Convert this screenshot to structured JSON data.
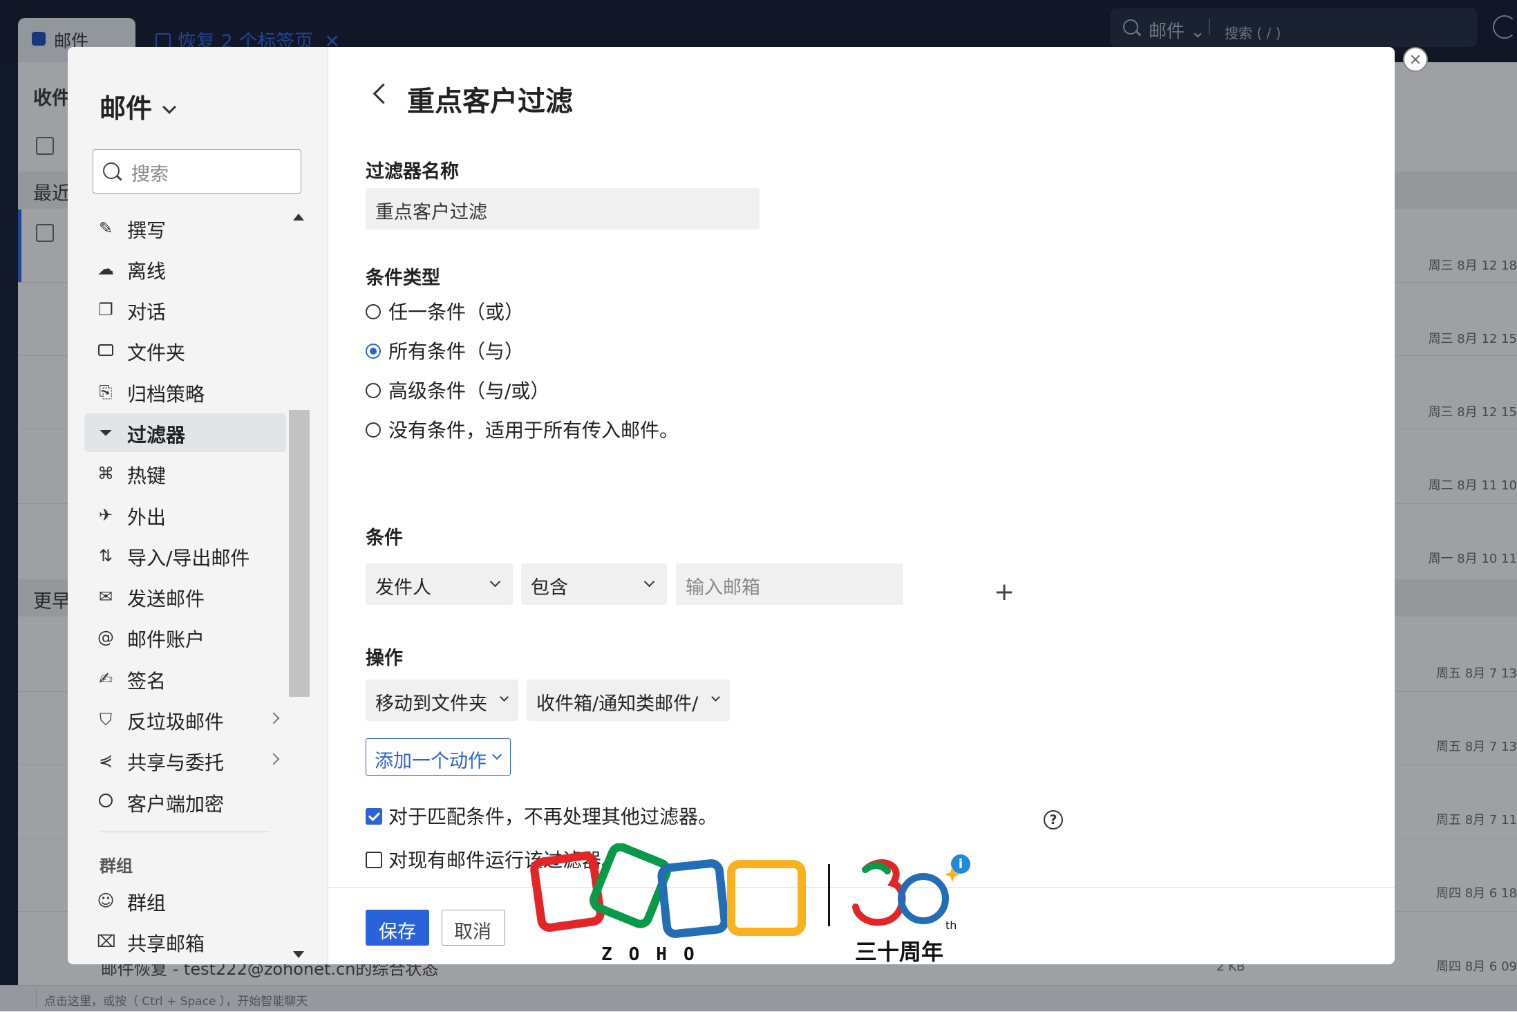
{
  "tabs": {
    "active_label": "邮件",
    "restore_label": "恢复 2 个标签页",
    "restore_close": "✕"
  },
  "top_search": {
    "scope": "邮件",
    "scope_caret": "⌄",
    "placeholder": "搜索 ( / )"
  },
  "background": {
    "folder_title": "收件",
    "group_recent": "最近",
    "group_earlier": "更早",
    "dates": [
      "周三 8月 12 18",
      "周三 8月 12 15",
      "周三 8月 12 15",
      "周二 8月 11 10",
      "周一 8月 10 11",
      "周五 8月 7 13",
      "周五 8月 7 13",
      "周五 8月 7 11",
      "周四 8月 6 18",
      "周四 8月 6 09"
    ],
    "last_subject": "邮件恢复 - test222@zohonet.cn的综合状态",
    "last_size": "2 KB",
    "status_hint": "点击这里，或按（ Ctrl + Space ），开始智能聊天"
  },
  "sidebar": {
    "title": "邮件",
    "search_placeholder": "搜索",
    "items": [
      {
        "label": "撰写",
        "icon": "compose-icon"
      },
      {
        "label": "离线",
        "icon": "offline-icon"
      },
      {
        "label": "对话",
        "icon": "conversation-icon"
      },
      {
        "label": "文件夹",
        "icon": "folder-icon"
      },
      {
        "label": "归档策略",
        "icon": "archive-icon"
      },
      {
        "label": "过滤器",
        "icon": "filter-icon",
        "selected": true
      },
      {
        "label": "热键",
        "icon": "hotkey-icon"
      },
      {
        "label": "外出",
        "icon": "out-of-office-icon"
      },
      {
        "label": "导入/导出邮件",
        "icon": "import-export-icon"
      },
      {
        "label": "发送邮件",
        "icon": "send-mail-icon"
      },
      {
        "label": "邮件账户",
        "icon": "at-icon"
      },
      {
        "label": "签名",
        "icon": "signature-icon"
      },
      {
        "label": "反垃圾邮件",
        "icon": "shield-icon",
        "has_submenu": true
      },
      {
        "label": "共享与委托",
        "icon": "share-icon",
        "has_submenu": true
      },
      {
        "label": "客户端加密",
        "icon": "encryption-icon"
      }
    ],
    "group_heading": "群组",
    "group_items": [
      {
        "label": "群组",
        "icon": "group-icon"
      },
      {
        "label": "共享邮箱",
        "icon": "shared-mailbox-icon"
      }
    ]
  },
  "filter": {
    "title": "重点客户过滤",
    "name_label": "过滤器名称",
    "name_value": "重点客户过滤",
    "condition_type_label": "条件类型",
    "condition_types": [
      {
        "label": "任一条件（或）",
        "checked": false
      },
      {
        "label": "所有条件（与）",
        "checked": true
      },
      {
        "label": "高级条件（与/或）",
        "checked": false
      },
      {
        "label": "没有条件，适用于所有传入邮件。",
        "checked": false
      }
    ],
    "conditions_label": "条件",
    "condition_field": "发件人",
    "condition_operator": "包含",
    "condition_value_placeholder": "输入邮箱",
    "add_condition": "+",
    "actions_label": "操作",
    "action_type": "移动到文件夹",
    "action_target": "收件箱/通知类邮件/",
    "add_action": "添加一个动作",
    "stop_processing_label": "对于匹配条件，不再处理其他过滤器。",
    "stop_processing_checked": true,
    "run_existing_label": "对现有邮件运行该过滤器。",
    "run_existing_checked": false,
    "help_glyph": "?",
    "info_glyph": "i",
    "save": "保存",
    "cancel": "取消"
  },
  "logo": {
    "wordmark": "ZOHO",
    "anniversary_number": "30",
    "anniversary_suffix": "th",
    "anniversary_text": "三十周年",
    "colors": {
      "red": "#e42527",
      "green": "#089949",
      "blue": "#226db4",
      "yellow": "#f9b21d"
    }
  }
}
